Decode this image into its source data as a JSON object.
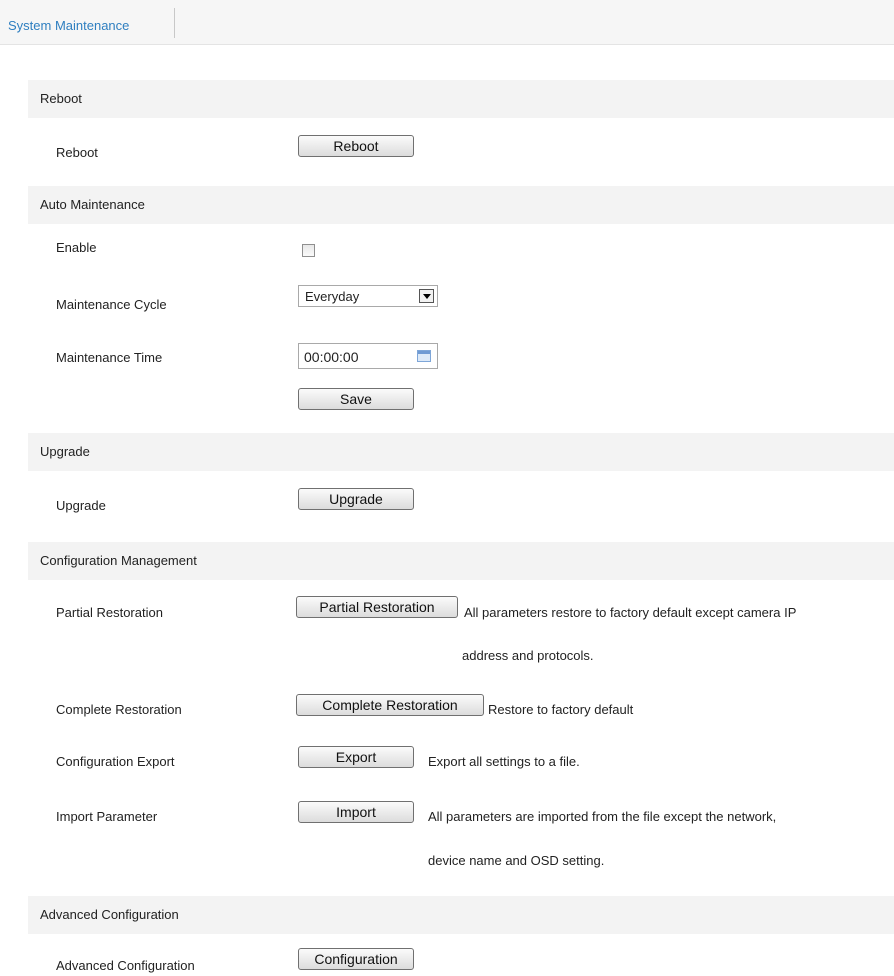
{
  "tabs": {
    "active": "System Maintenance"
  },
  "reboot": {
    "section_title": "Reboot",
    "label": "Reboot",
    "button": "Reboot"
  },
  "auto_maintenance": {
    "section_title": "Auto Maintenance",
    "enable_label": "Enable",
    "enable_checked": false,
    "cycle_label": "Maintenance Cycle",
    "cycle_value": "Everyday",
    "time_label": "Maintenance Time",
    "time_value": "00:00:00",
    "save_button": "Save"
  },
  "upgrade": {
    "section_title": "Upgrade",
    "label": "Upgrade",
    "button": "Upgrade"
  },
  "config_mgmt": {
    "section_title": "Configuration Management",
    "partial": {
      "label": "Partial Restoration",
      "button": "Partial Restoration",
      "desc_line1": "All parameters restore to factory default except camera IP",
      "desc_line2": "address and protocols."
    },
    "complete": {
      "label": "Complete Restoration",
      "button": "Complete Restoration",
      "desc": "Restore to factory default"
    },
    "export": {
      "label": "Configuration Export",
      "button": "Export",
      "desc": "Export all settings to a file."
    },
    "import": {
      "label": "Import Parameter",
      "button": "Import",
      "desc_line1": "All parameters are imported from the file except the network,",
      "desc_line2": "device name and OSD setting."
    }
  },
  "advanced": {
    "section_title": "Advanced Configuration",
    "label": "Advanced Configuration",
    "button": "Configuration"
  }
}
